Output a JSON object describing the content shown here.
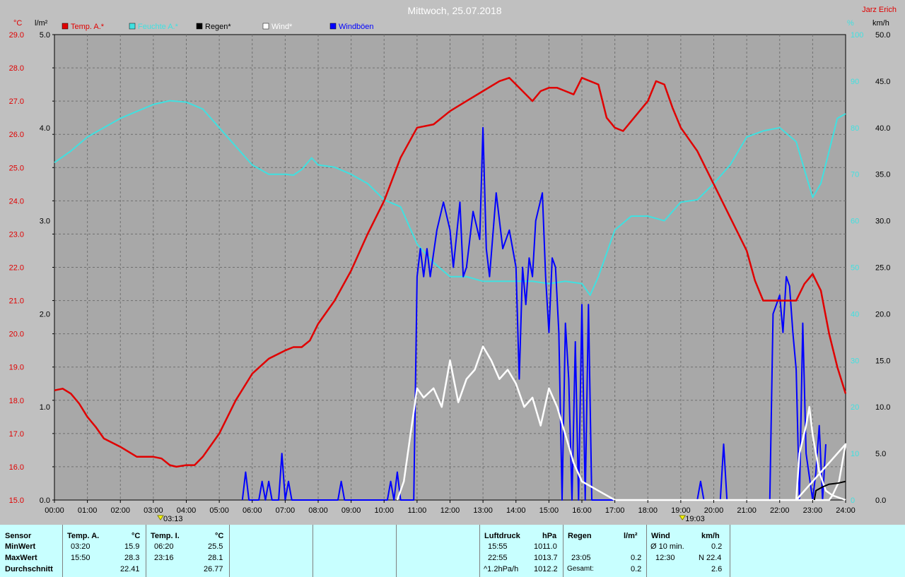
{
  "header": {
    "title": "Mittwoch, 25.07.2018",
    "author": "Jarz Erich"
  },
  "legend": [
    {
      "label": "Temp. A.*",
      "color": "#e00000"
    },
    {
      "label": "Feuchte A.*",
      "color": "#40e0e0"
    },
    {
      "label": "Regen*",
      "color": "#000000"
    },
    {
      "label": "Wind*",
      "color": "#ffffff"
    },
    {
      "label": "Windböen",
      "color": "#0000ff"
    }
  ],
  "axes": {
    "temp_unit": "°C",
    "rain_unit": "l/m²",
    "humidity_unit": "%",
    "wind_unit": "km/h",
    "temp_ticks": [
      "29.0",
      "28.0",
      "27.0",
      "26.0",
      "25.0",
      "24.0",
      "23.0",
      "22.0",
      "21.0",
      "20.0",
      "19.0",
      "18.0",
      "17.0",
      "16.0",
      "15.0"
    ],
    "rain_ticks": [
      "5.0",
      "4.0",
      "3.0",
      "2.0",
      "1.0",
      "0.0"
    ],
    "humidity_ticks": [
      "100",
      "90",
      "80",
      "70",
      "60",
      "50",
      "40",
      "30",
      "20",
      "10",
      "0"
    ],
    "wind_ticks": [
      "50.0",
      "45.0",
      "40.0",
      "35.0",
      "30.0",
      "25.0",
      "20.0",
      "15.0",
      "10.0",
      "5.0",
      "0.0"
    ],
    "time_ticks": [
      "00:00",
      "01:00",
      "02:00",
      "03:00",
      "04:00",
      "05:00",
      "06:00",
      "07:00",
      "08:00",
      "09:00",
      "10:00",
      "11:00",
      "12:00",
      "13:00",
      "14:00",
      "15:00",
      "16:00",
      "17:00",
      "18:00",
      "19:00",
      "20:00",
      "21:00",
      "22:00",
      "23:00",
      "24:00"
    ]
  },
  "sun_markers": {
    "sunrise": "03:13",
    "sunset": "19:03"
  },
  "chart_data": {
    "type": "line",
    "title": "Mittwoch, 25.07.2018",
    "xlabel": "",
    "x_range_hours": [
      0,
      24
    ],
    "temp_range": [
      15,
      29
    ],
    "rain_range": [
      0,
      5
    ],
    "humidity_range": [
      0,
      100
    ],
    "wind_range": [
      0,
      50
    ],
    "series": [
      {
        "name": "Temp. A.*",
        "axis": "temp",
        "color": "#e00000",
        "points": [
          [
            0,
            18.3
          ],
          [
            0.25,
            18.35
          ],
          [
            0.5,
            18.2
          ],
          [
            0.75,
            17.9
          ],
          [
            1,
            17.5
          ],
          [
            1.25,
            17.2
          ],
          [
            1.5,
            16.85
          ],
          [
            2,
            16.6
          ],
          [
            2.5,
            16.3
          ],
          [
            3,
            16.3
          ],
          [
            3.25,
            16.25
          ],
          [
            3.5,
            16.05
          ],
          [
            3.7,
            16.0
          ],
          [
            4,
            16.05
          ],
          [
            4.25,
            16.05
          ],
          [
            4.5,
            16.3
          ],
          [
            5,
            17.0
          ],
          [
            5.5,
            18.0
          ],
          [
            6,
            18.8
          ],
          [
            6.5,
            19.25
          ],
          [
            7,
            19.5
          ],
          [
            7.25,
            19.6
          ],
          [
            7.5,
            19.6
          ],
          [
            7.75,
            19.8
          ],
          [
            8,
            20.3
          ],
          [
            8.5,
            21.0
          ],
          [
            9,
            21.9
          ],
          [
            9.5,
            23.0
          ],
          [
            10,
            24.0
          ],
          [
            10.5,
            25.3
          ],
          [
            11,
            26.2
          ],
          [
            11.5,
            26.3
          ],
          [
            12,
            26.7
          ],
          [
            12.5,
            27.0
          ],
          [
            13,
            27.3
          ],
          [
            13.5,
            27.6
          ],
          [
            13.8,
            27.7
          ],
          [
            14,
            27.5
          ],
          [
            14.5,
            27.0
          ],
          [
            14.75,
            27.3
          ],
          [
            15,
            27.4
          ],
          [
            15.25,
            27.4
          ],
          [
            15.5,
            27.3
          ],
          [
            15.75,
            27.2
          ],
          [
            16,
            27.7
          ],
          [
            16.5,
            27.5
          ],
          [
            16.75,
            26.5
          ],
          [
            17,
            26.2
          ],
          [
            17.25,
            26.1
          ],
          [
            17.5,
            26.4
          ],
          [
            18,
            27.0
          ],
          [
            18.25,
            27.6
          ],
          [
            18.5,
            27.5
          ],
          [
            18.75,
            26.8
          ],
          [
            19,
            26.2
          ],
          [
            19.5,
            25.5
          ],
          [
            20,
            24.5
          ],
          [
            20.5,
            23.5
          ],
          [
            21,
            22.5
          ],
          [
            21.25,
            21.6
          ],
          [
            21.5,
            21.0
          ],
          [
            22,
            21.0
          ],
          [
            22.5,
            21.0
          ],
          [
            22.75,
            21.5
          ],
          [
            23,
            21.8
          ],
          [
            23.25,
            21.3
          ],
          [
            23.5,
            20.0
          ],
          [
            23.75,
            19.0
          ],
          [
            24,
            18.2
          ]
        ]
      },
      {
        "name": "Feuchte A.*",
        "axis": "humidity",
        "color": "#40e0e0",
        "points": [
          [
            0,
            72.5
          ],
          [
            0.5,
            75
          ],
          [
            1,
            78
          ],
          [
            1.5,
            80
          ],
          [
            2,
            82
          ],
          [
            2.5,
            83.5
          ],
          [
            3,
            85
          ],
          [
            3.5,
            85.8
          ],
          [
            4,
            85.5
          ],
          [
            4.5,
            84
          ],
          [
            5,
            80
          ],
          [
            5.5,
            76
          ],
          [
            6,
            72
          ],
          [
            6.5,
            70
          ],
          [
            7,
            70
          ],
          [
            7.25,
            69.8
          ],
          [
            7.5,
            71
          ],
          [
            7.8,
            73.5
          ],
          [
            8,
            72
          ],
          [
            8.5,
            71.5
          ],
          [
            9,
            70
          ],
          [
            9.5,
            68
          ],
          [
            10,
            64.5
          ],
          [
            10.5,
            63
          ],
          [
            11,
            55
          ],
          [
            11.5,
            51
          ],
          [
            12,
            48
          ],
          [
            12.5,
            48
          ],
          [
            13,
            47
          ],
          [
            13.5,
            47
          ],
          [
            14,
            47
          ],
          [
            14.5,
            47
          ],
          [
            15,
            46.5
          ],
          [
            15.5,
            47
          ],
          [
            16,
            46.5
          ],
          [
            16.25,
            44
          ],
          [
            16.5,
            48
          ],
          [
            16.75,
            53
          ],
          [
            17,
            58
          ],
          [
            17.5,
            61
          ],
          [
            18,
            61
          ],
          [
            18.5,
            60
          ],
          [
            19,
            64
          ],
          [
            19.5,
            64.5
          ],
          [
            20,
            68
          ],
          [
            20.5,
            72
          ],
          [
            21,
            78
          ],
          [
            21.5,
            79.3
          ],
          [
            22,
            80
          ],
          [
            22.5,
            77
          ],
          [
            23,
            65
          ],
          [
            23.25,
            68
          ],
          [
            23.5,
            75
          ],
          [
            23.75,
            82
          ],
          [
            24,
            83
          ]
        ]
      },
      {
        "name": "Regen*",
        "axis": "rain",
        "color": "#000000",
        "points": [
          [
            23.05,
            0
          ],
          [
            23.1,
            0.1
          ],
          [
            23.3,
            0.14
          ],
          [
            23.5,
            0.17
          ],
          [
            23.75,
            0.18
          ],
          [
            24,
            0.2
          ]
        ]
      },
      {
        "name": "Wind*",
        "axis": "wind",
        "color": "#ffffff",
        "points": [
          [
            10.4,
            0
          ],
          [
            10.6,
            2
          ],
          [
            10.8,
            7
          ],
          [
            11,
            12
          ],
          [
            11.2,
            11
          ],
          [
            11.5,
            12
          ],
          [
            11.75,
            10
          ],
          [
            12,
            15
          ],
          [
            12.25,
            10.5
          ],
          [
            12.5,
            13
          ],
          [
            12.75,
            14
          ],
          [
            13,
            16.5
          ],
          [
            13.25,
            15
          ],
          [
            13.5,
            13
          ],
          [
            13.75,
            14
          ],
          [
            14,
            12.5
          ],
          [
            14.25,
            10
          ],
          [
            14.5,
            11
          ],
          [
            14.75,
            8
          ],
          [
            15,
            12
          ],
          [
            15.25,
            10
          ],
          [
            15.5,
            7
          ],
          [
            15.75,
            4
          ],
          [
            16,
            2
          ],
          [
            16.5,
            1
          ],
          [
            17,
            0
          ],
          [
            23.5,
            0
          ],
          [
            23.6,
            0.5
          ],
          [
            23.8,
            2
          ],
          [
            23.9,
            4
          ],
          [
            24,
            6
          ],
          [
            22.5,
            0
          ],
          [
            22.6,
            5
          ],
          [
            22.8,
            8
          ],
          [
            22.9,
            10
          ],
          [
            23.0,
            7
          ],
          [
            23.2,
            3
          ],
          [
            23.4,
            1
          ],
          [
            23.6,
            0.5
          ],
          [
            24,
            0
          ]
        ]
      },
      {
        "name": "Windböen",
        "axis": "wind",
        "color": "#0000ff",
        "points": [
          [
            5.7,
            0
          ],
          [
            5.8,
            3
          ],
          [
            5.9,
            0
          ],
          [
            6.2,
            0
          ],
          [
            6.3,
            2
          ],
          [
            6.4,
            0
          ],
          [
            6.5,
            2
          ],
          [
            6.6,
            0
          ],
          [
            6.8,
            0
          ],
          [
            6.9,
            5
          ],
          [
            7.0,
            0
          ],
          [
            7.1,
            2
          ],
          [
            7.2,
            0
          ],
          [
            8.6,
            0
          ],
          [
            8.7,
            2
          ],
          [
            8.8,
            0
          ],
          [
            10.1,
            0
          ],
          [
            10.2,
            2
          ],
          [
            10.3,
            0
          ],
          [
            10.4,
            3
          ],
          [
            10.5,
            0
          ],
          [
            10.9,
            0
          ],
          [
            11.0,
            24
          ],
          [
            11.1,
            27
          ],
          [
            11.2,
            24
          ],
          [
            11.3,
            27
          ],
          [
            11.4,
            24
          ],
          [
            11.6,
            29
          ],
          [
            11.8,
            32
          ],
          [
            12.0,
            29
          ],
          [
            12.1,
            25
          ],
          [
            12.3,
            32
          ],
          [
            12.4,
            24
          ],
          [
            12.5,
            25
          ],
          [
            12.7,
            31
          ],
          [
            12.9,
            28
          ],
          [
            13.0,
            40
          ],
          [
            13.1,
            27
          ],
          [
            13.2,
            24
          ],
          [
            13.4,
            33
          ],
          [
            13.6,
            27
          ],
          [
            13.8,
            29
          ],
          [
            14.0,
            25
          ],
          [
            14.1,
            13
          ],
          [
            14.2,
            25
          ],
          [
            14.3,
            21
          ],
          [
            14.4,
            26
          ],
          [
            14.5,
            24
          ],
          [
            14.6,
            30
          ],
          [
            14.8,
            33
          ],
          [
            14.9,
            24
          ],
          [
            15.0,
            18
          ],
          [
            15.1,
            26
          ],
          [
            15.2,
            25
          ],
          [
            15.3,
            18
          ],
          [
            15.4,
            0
          ],
          [
            15.5,
            19
          ],
          [
            15.6,
            13
          ],
          [
            15.7,
            0
          ],
          [
            15.8,
            17
          ],
          [
            15.9,
            0
          ],
          [
            16.0,
            21
          ],
          [
            16.1,
            0
          ],
          [
            16.2,
            21
          ],
          [
            16.3,
            0
          ],
          [
            19.5,
            0
          ],
          [
            19.6,
            2
          ],
          [
            19.7,
            0
          ],
          [
            20.2,
            0
          ],
          [
            20.3,
            6
          ],
          [
            20.4,
            0
          ],
          [
            21.7,
            0
          ],
          [
            21.8,
            20
          ],
          [
            22.0,
            22
          ],
          [
            22.1,
            18
          ],
          [
            22.2,
            24
          ],
          [
            22.3,
            23
          ],
          [
            22.4,
            18
          ],
          [
            22.5,
            14
          ],
          [
            22.6,
            0
          ],
          [
            22.7,
            19
          ],
          [
            22.8,
            5
          ],
          [
            23.0,
            0
          ],
          [
            23.1,
            3
          ],
          [
            23.2,
            8
          ],
          [
            23.3,
            0
          ],
          [
            23.4,
            6
          ]
        ]
      }
    ]
  },
  "table": {
    "col_sensor": {
      "header": "Sensor",
      "rows": [
        "MinWert",
        "MaxWert",
        "Durchschnitt"
      ]
    },
    "col_tempA": {
      "header": "Temp. A.",
      "unit": "°C",
      "min_time": "03:20",
      "min_val": "15.9",
      "max_time": "15:50",
      "max_val": "28.3",
      "avg": "22.41"
    },
    "col_tempI": {
      "header": "Temp. I.",
      "unit": "°C",
      "min_time": "06:20",
      "min_val": "25.5",
      "max_time": "23:16",
      "max_val": "28.1",
      "avg": "26.77"
    },
    "col_pressure": {
      "header": "Luftdruck",
      "unit": "hPa",
      "min_time": "15:55",
      "min_val": "1011.0",
      "max_time": "22:55",
      "max_val": "1013.7",
      "trend_label": "^1.2hPa/h",
      "trend_val": "1012.2"
    },
    "col_rain": {
      "header": "Regen",
      "unit": "l/m²",
      "max_time": "23:05",
      "max_val": "0.2",
      "total_label": "Gesamt:",
      "total_val": "0.2"
    },
    "col_wind": {
      "header": "Wind",
      "unit": "km/h",
      "avg_label": "Ø 10 min.",
      "avg_val": "0.2",
      "max_time": "12:30",
      "max_val": "N 22.4",
      "day_avg": "2.6"
    }
  }
}
